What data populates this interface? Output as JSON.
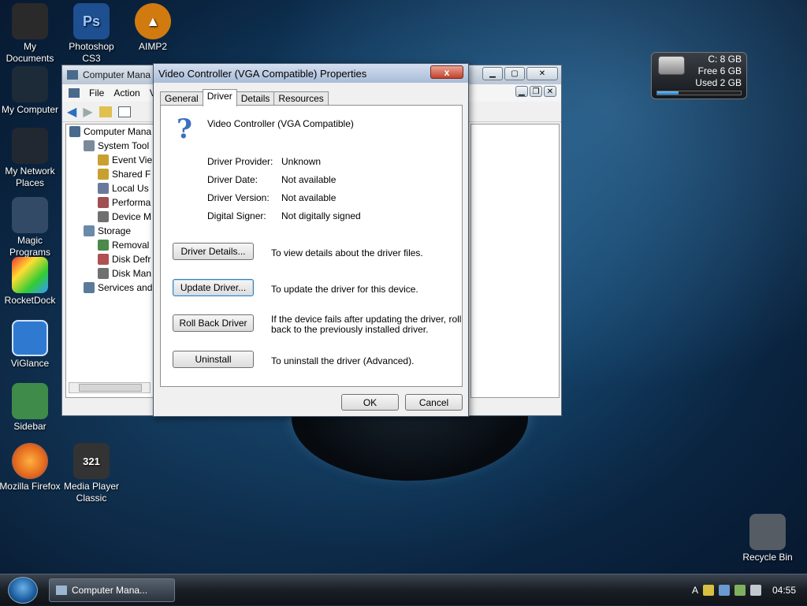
{
  "desktop_icons": [
    {
      "label": "My Documents",
      "icon": "folder-icon",
      "color": "#2a2a2a"
    },
    {
      "label": "Photoshop CS3",
      "icon": "photoshop-icon",
      "color": "#1d4f91"
    },
    {
      "label": "AIMP2",
      "icon": "aimp-icon",
      "color": "#d07a10"
    },
    {
      "label": "My Computer",
      "icon": "computer-icon",
      "color": "#1d2b38"
    },
    {
      "label": "My Network Places",
      "icon": "network-icon",
      "color": "#222831"
    },
    {
      "label": "Magic Programs",
      "icon": "magic-icon",
      "color": "#324a66"
    },
    {
      "label": "RocketDock",
      "icon": "rocketdock-icon",
      "color": "#1c2c3c"
    },
    {
      "label": "ViGlance",
      "icon": "viglance-icon",
      "color": "#2f7ad0"
    },
    {
      "label": "Sidebar",
      "icon": "sidebar-icon",
      "color": "#3f8b4a"
    },
    {
      "label": "Mozilla Firefox",
      "icon": "firefox-icon",
      "color": "#e2661c"
    },
    {
      "label": "Media Player Classic",
      "icon": "mpc-icon",
      "color": "#333333"
    },
    {
      "label": "Recycle Bin",
      "icon": "recycle-bin-icon",
      "color": "#555c63"
    }
  ],
  "gadget": {
    "c": "C:  8 GB",
    "free": "Free 6 GB",
    "used": "Used 2 GB",
    "used_fraction": 0.25
  },
  "computer_management": {
    "title": "Computer Mana",
    "menu": [
      "File",
      "Action",
      "V"
    ],
    "tree": [
      {
        "label": "Computer Mana",
        "indent": 0
      },
      {
        "label": "System Tool",
        "indent": 1
      },
      {
        "label": "Event Vie",
        "indent": 2
      },
      {
        "label": "Shared F",
        "indent": 2
      },
      {
        "label": "Local Us",
        "indent": 2
      },
      {
        "label": "Performa",
        "indent": 2
      },
      {
        "label": "Device M",
        "indent": 2
      },
      {
        "label": "Storage",
        "indent": 1
      },
      {
        "label": "Removal",
        "indent": 2
      },
      {
        "label": "Disk Defr",
        "indent": 2
      },
      {
        "label": "Disk Man",
        "indent": 2
      },
      {
        "label": "Services and",
        "indent": 1
      }
    ]
  },
  "dialog": {
    "title": "Video Controller (VGA Compatible) Properties",
    "close": "x",
    "tabs": [
      "General",
      "Driver",
      "Details",
      "Resources"
    ],
    "active_tab": "Driver",
    "device_name": "Video Controller (VGA Compatible)",
    "info": [
      {
        "label": "Driver Provider:",
        "value": "Unknown"
      },
      {
        "label": "Driver Date:",
        "value": "Not available"
      },
      {
        "label": "Driver Version:",
        "value": "Not available"
      },
      {
        "label": "Digital Signer:",
        "value": "Not digitally signed"
      }
    ],
    "actions": [
      {
        "button": "Driver Details...",
        "desc": "To view details about the driver files."
      },
      {
        "button": "Update Driver...",
        "desc": "To update the driver for this device."
      },
      {
        "button": "Roll Back Driver",
        "desc": "If the device fails after updating the driver, roll\nback to the previously installed driver."
      },
      {
        "button": "Uninstall",
        "desc": "To uninstall the driver (Advanced)."
      }
    ],
    "ok": "OK",
    "cancel": "Cancel"
  },
  "taskbar": {
    "task_label": "Computer Mana...",
    "lang": "A",
    "time": "04:55"
  }
}
